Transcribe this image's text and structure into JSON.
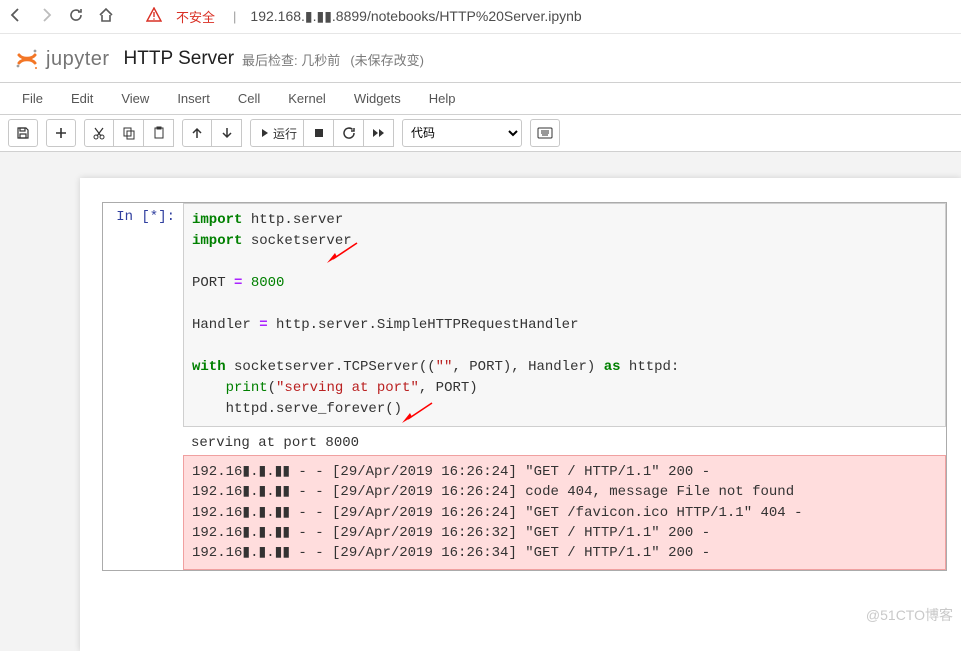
{
  "browser": {
    "insecure_label": "不安全",
    "url": "192.168.▮.▮▮.8899/notebooks/HTTP%20Server.ipynb"
  },
  "header": {
    "brand": "jupyter",
    "notebook_name": "HTTP Server",
    "checkpoint_label": "最后检查:",
    "checkpoint_value": "几秒前",
    "unsaved": "(未保存改变)"
  },
  "menu": {
    "file": "File",
    "edit": "Edit",
    "view": "View",
    "insert": "Insert",
    "cell": "Cell",
    "kernel": "Kernel",
    "widgets": "Widgets",
    "help": "Help"
  },
  "toolbar": {
    "run_text": "运行",
    "celltype": "代码"
  },
  "cell": {
    "prompt": "In [*]:",
    "code": {
      "line1_kw": "import",
      "line1_rest": " http.server",
      "line2_kw": "import",
      "line2_rest": " socketserver",
      "blank": "",
      "line3_a": "PORT ",
      "line3_op": "=",
      "line3_b": " ",
      "line3_num": "8000",
      "line4_a": "Handler ",
      "line4_op": "=",
      "line4_b": " http.server.SimpleHTTPRequestHandler",
      "line5_kw1": "with",
      "line5_a": " socketserver.TCPServer((",
      "line5_str1": "\"\"",
      "line5_b": ", PORT), Handler) ",
      "line5_kw2": "as",
      "line5_c": " httpd:",
      "line6_indent": "    ",
      "line6_print": "print",
      "line6_a": "(",
      "line6_str": "\"serving at port\"",
      "line6_b": ", PORT)",
      "line7_indent": "    ",
      "line7_a": "httpd.serve_forever()"
    },
    "output_text": "serving at port 8000",
    "stderr_lines": [
      "192.16▮.▮.▮▮ - - [29/Apr/2019 16:26:24] \"GET / HTTP/1.1\" 200 -",
      "192.16▮.▮.▮▮ - - [29/Apr/2019 16:26:24] code 404, message File not found",
      "192.16▮.▮.▮▮ - - [29/Apr/2019 16:26:24] \"GET /favicon.ico HTTP/1.1\" 404 -",
      "192.16▮.▮.▮▮ - - [29/Apr/2019 16:26:32] \"GET / HTTP/1.1\" 200 -",
      "192.16▮.▮.▮▮ - - [29/Apr/2019 16:26:34] \"GET / HTTP/1.1\" 200 -"
    ]
  },
  "watermark": "@51CTO博客"
}
